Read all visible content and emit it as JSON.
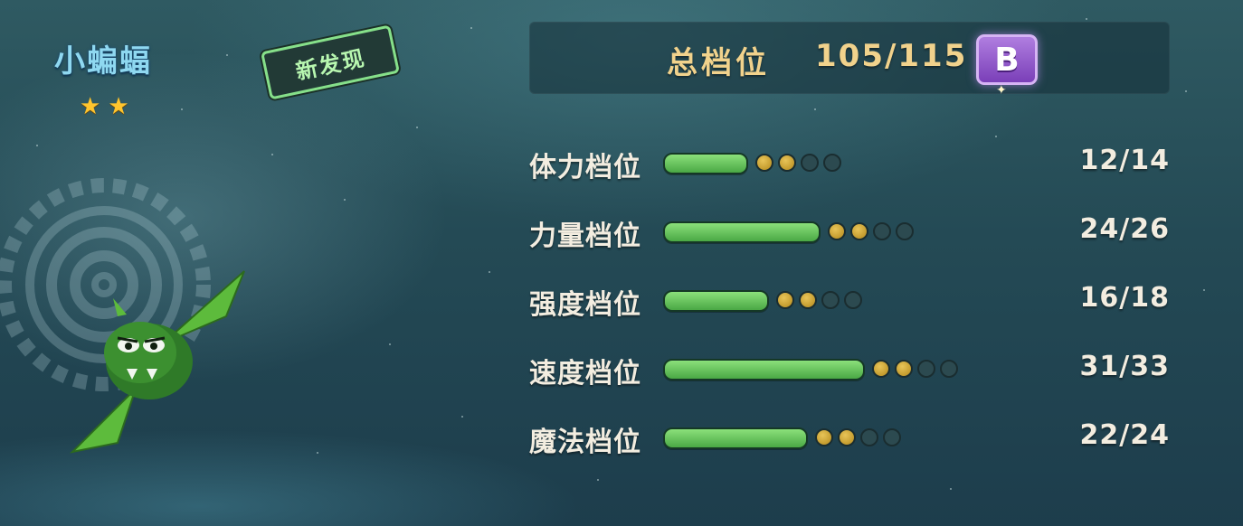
{
  "pet": {
    "name": "小蝙蝠",
    "stars": 2,
    "star_glyph": "★",
    "new_badge": "新发现"
  },
  "total": {
    "label": "总档位",
    "value": "105/115",
    "grade": "B",
    "grade_color": "#8e4fcf"
  },
  "stats": [
    {
      "label": "体力档位",
      "value": "12/14",
      "fill": 0.39,
      "filled_dots": 2,
      "dots": 4
    },
    {
      "label": "力量档位",
      "value": "24/26",
      "fill": 0.74,
      "filled_dots": 2,
      "dots": 4
    },
    {
      "label": "强度档位",
      "value": "16/18",
      "fill": 0.49,
      "filled_dots": 2,
      "dots": 4
    },
    {
      "label": "速度档位",
      "value": "31/33",
      "fill": 0.95,
      "filled_dots": 2,
      "dots": 4
    },
    {
      "label": "魔法档位",
      "value": "22/24",
      "fill": 0.68,
      "filled_dots": 2,
      "dots": 4
    }
  ],
  "colors": {
    "bar": "#5fbf55",
    "dot_on": "#d2a836",
    "dot_off": "#2c4a50",
    "label": "#f1d28c"
  },
  "icons": {
    "sparkle": "✦",
    "creature": "green-bat-creature-icon",
    "emblem": "tribal-circle-emblem-icon"
  }
}
